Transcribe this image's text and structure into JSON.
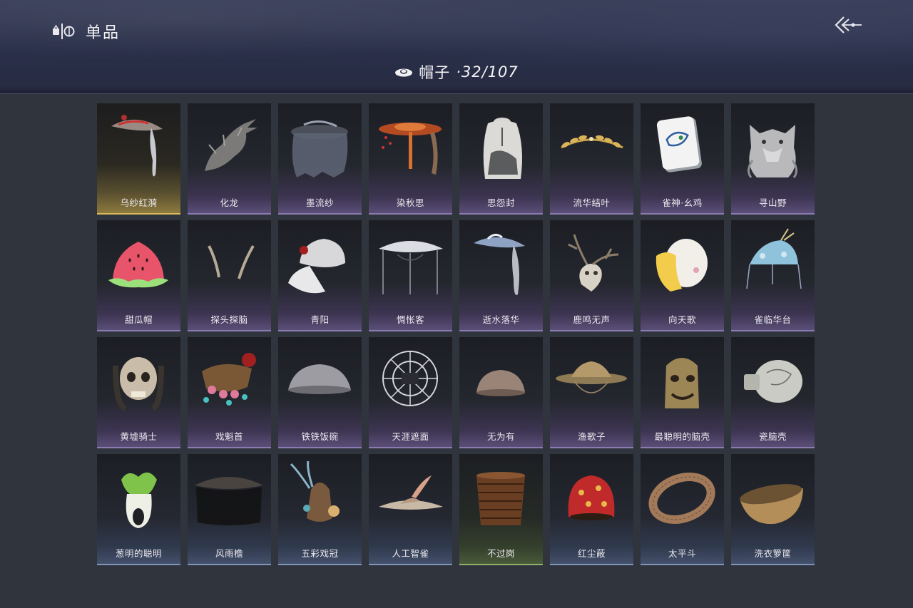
{
  "header": {
    "title": "单品",
    "brand_icon": "wardrobe-icon",
    "back_icon": "back-arrow-icon",
    "category_icon": "hat-icon",
    "category_name": "帽子",
    "category_count": "·32/107"
  },
  "items": [
    {
      "name": "乌纱红漪",
      "icon": "veiled-hat",
      "rarity": "gold"
    },
    {
      "name": "化龙",
      "icon": "dragon-head",
      "rarity": "purple"
    },
    {
      "name": "墨流纱",
      "icon": "veil-hood",
      "rarity": "purple"
    },
    {
      "name": "染秋思",
      "icon": "autumn-hat",
      "rarity": "purple"
    },
    {
      "name": "思怨封",
      "icon": "ink-hood",
      "rarity": "purple"
    },
    {
      "name": "流华结叶",
      "icon": "leaf-crown",
      "rarity": "purple"
    },
    {
      "name": "雀神·幺鸡",
      "icon": "mahjong-tile",
      "rarity": "purple"
    },
    {
      "name": "寻山野",
      "icon": "wolf-head",
      "rarity": "purple"
    },
    {
      "name": "甜瓜帽",
      "icon": "melon-hat",
      "rarity": "purple"
    },
    {
      "name": "探头探脑",
      "icon": "antenna",
      "rarity": "purple"
    },
    {
      "name": "青阳",
      "icon": "white-cap",
      "rarity": "purple"
    },
    {
      "name": "惆怅客",
      "icon": "conical-veil-hat",
      "rarity": "purple"
    },
    {
      "name": "逝水落华",
      "icon": "veiled-hat-blue",
      "rarity": "purple"
    },
    {
      "name": "鹿鸣无声",
      "icon": "deer-skull",
      "rarity": "purple"
    },
    {
      "name": "向天歌",
      "icon": "duck-head",
      "rarity": "purple"
    },
    {
      "name": "雀临华台",
      "icon": "phoenix-crown",
      "rarity": "purple"
    },
    {
      "name": "黄墟骑士",
      "icon": "skull-dreadlocks",
      "rarity": "purple"
    },
    {
      "name": "戏魁首",
      "icon": "opera-headdress",
      "rarity": "purple"
    },
    {
      "name": "铁铁饭碗",
      "icon": "iron-bowl",
      "rarity": "purple"
    },
    {
      "name": "天涯遮面",
      "icon": "wire-hat",
      "rarity": "purple"
    },
    {
      "name": "无为有",
      "icon": "clay-bowl",
      "rarity": "purple"
    },
    {
      "name": "渔歌子",
      "icon": "straw-hat",
      "rarity": "purple"
    },
    {
      "name": "最聪明的脑壳",
      "icon": "bell-mask",
      "rarity": "purple"
    },
    {
      "name": "瓷脑壳",
      "icon": "porcelain-jar",
      "rarity": "purple"
    },
    {
      "name": "葱明的聪明",
      "icon": "bok-choy",
      "rarity": "blue"
    },
    {
      "name": "风雨檐",
      "icon": "black-veil-hat",
      "rarity": "blue"
    },
    {
      "name": "五彩戏冠",
      "icon": "feather-cap",
      "rarity": "blue"
    },
    {
      "name": "人工智雀",
      "icon": "bird-hat",
      "rarity": "blue"
    },
    {
      "name": "不过岗",
      "icon": "stacked-bowls",
      "rarity": "green"
    },
    {
      "name": "红尘蔽",
      "icon": "red-cap",
      "rarity": "blue"
    },
    {
      "name": "太平斗",
      "icon": "woven-ring",
      "rarity": "blue"
    },
    {
      "name": "洗衣箩筐",
      "icon": "woven-basket",
      "rarity": "blue"
    }
  ]
}
